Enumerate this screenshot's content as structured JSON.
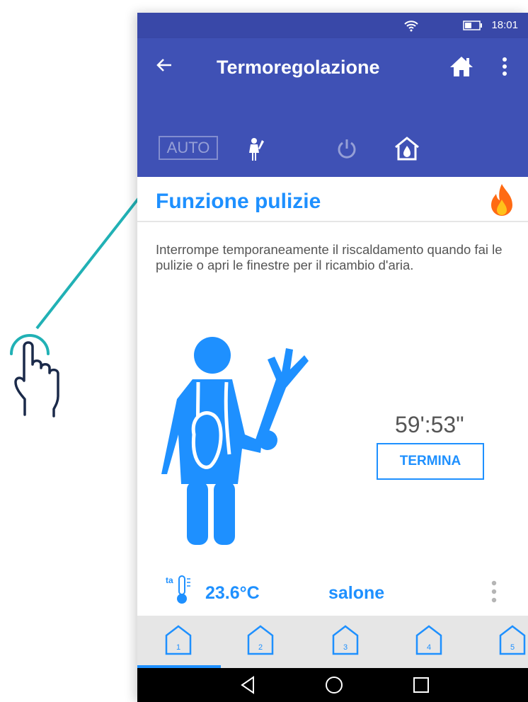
{
  "status_bar": {
    "time": "18:01"
  },
  "app_bar": {
    "title": "Termoregolazione"
  },
  "mode_bar": {
    "auto_label": "AUTO"
  },
  "function": {
    "title": "Funzione pulizie",
    "description": "Interrompe temporaneamente il riscaldamento quando fai le pulizie o apri le finestre per il ricambio d'aria.",
    "timer": "59':53\"",
    "end_button": "TERMINA"
  },
  "zone": {
    "temperature": "23.6°C",
    "temp_prefix": "ta",
    "room": "salone"
  },
  "tabs": [
    "1",
    "2",
    "3",
    "4",
    "5"
  ],
  "colors": {
    "primary": "#3f51b5",
    "accent": "#1e90ff",
    "teal": "#21b1b5"
  }
}
